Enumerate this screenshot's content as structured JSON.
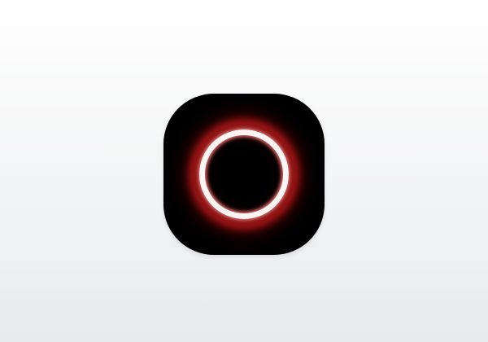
{
  "app_icon": {
    "icon": "neon-ring-icon",
    "background_color": "#000000",
    "ring_color": "#fff4f4",
    "glow_color": "#ff2a2a"
  },
  "page": {
    "background_color": "#f3f4f5"
  }
}
